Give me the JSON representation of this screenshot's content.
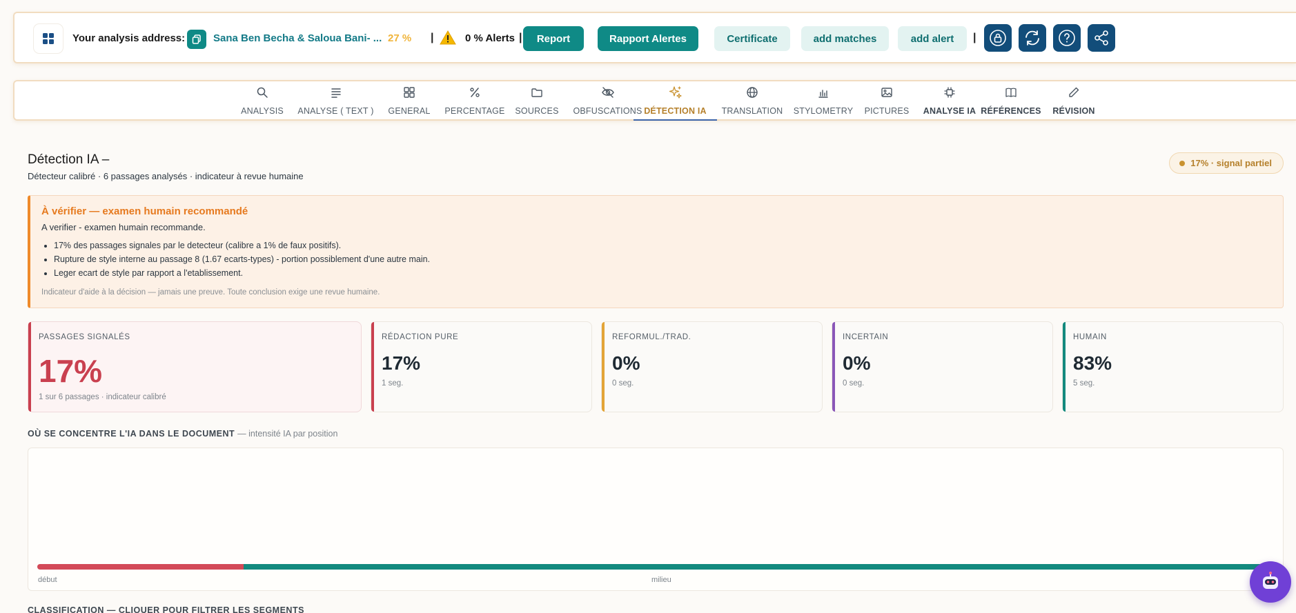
{
  "topbar": {
    "address_label": "Your analysis address:",
    "address_name": "Sana Ben Becha & Saloua Bani- ...",
    "percent": "27 %",
    "alerts": "0 % Alerts",
    "buttons": {
      "report": "Report",
      "rapport_alertes": "Rapport Alertes",
      "certificate": "Certificate",
      "add_matches": "add matches",
      "add_alert": "add alert"
    },
    "separator": "|",
    "icons": [
      "lock-icon",
      "refresh-icon",
      "help-icon",
      "share-icon"
    ]
  },
  "nav": {
    "tabs": [
      {
        "label": "ANALYSIS",
        "icon": "search-icon"
      },
      {
        "label": "ANALYSE ( TEXT )",
        "icon": "text-lines-icon"
      },
      {
        "label": "GENERAL",
        "icon": "grid-icon"
      },
      {
        "label": "PERCENTAGE",
        "icon": "percent-icon"
      },
      {
        "label": "SOURCES",
        "icon": "folder-icon"
      },
      {
        "label": "OBFUSCATIONS",
        "icon": "eye-off-icon"
      },
      {
        "label": "DÉTECTION IA",
        "icon": "sparkles-icon",
        "active": true
      },
      {
        "label": "TRANSLATION",
        "icon": "globe-icon"
      },
      {
        "label": "STYLOMETRY",
        "icon": "bar-chart-icon"
      },
      {
        "label": "PICTURES",
        "icon": "image-icon"
      },
      {
        "label": "ANALYSE IA",
        "icon": "chip-icon"
      },
      {
        "label": "RÉFÉRENCES",
        "icon": "book-icon"
      },
      {
        "label": "RÉVISION",
        "icon": "pencil-icon"
      }
    ]
  },
  "header": {
    "title": "Détection IA –",
    "subtitle": "Détecteur calibré · 6 passages analysés · indicateur à revue humaine",
    "signal": "17% · signal partiel"
  },
  "warning": {
    "title": "À vérifier — examen humain recommandé",
    "text": "A verifier - examen humain recommande.",
    "items": [
      "17% des passages signales par le detecteur (calibre a 1% de faux positifs).",
      "Rupture de style interne au passage 8 (1.67 ecarts-types) - portion possiblement d'une autre main.",
      "Leger ecart de style par rapport a l'etablissement."
    ],
    "note": "Indicateur d'aide à la décision — jamais une preuve. Toute conclusion exige une revue humaine."
  },
  "cards": [
    {
      "label": "PASSAGES SIGNALÉS",
      "value": "17%",
      "sub": "1 sur 6 passages · indicateur calibré",
      "color": "#c9404f"
    },
    {
      "label": "RÉDACTION PURE",
      "value": "17%",
      "sub": "1 seg.",
      "color": "#c9404f"
    },
    {
      "label": "REFORMUL./TRAD.",
      "value": "0%",
      "sub": "0 seg.",
      "color": "#e3a437"
    },
    {
      "label": "INCERTAIN",
      "value": "0%",
      "sub": "0 seg.",
      "color": "#8a57b8"
    },
    {
      "label": "HUMAIN",
      "value": "83%",
      "sub": "5 seg.",
      "color": "#138a7e"
    }
  ],
  "distribution": {
    "title": "OÙ SE CONCENTRE L'IA DANS LE DOCUMENT",
    "title_note": "— intensité IA par position",
    "segments": [
      {
        "share": 0.167,
        "color": "#d34a58"
      },
      {
        "share": 0.833,
        "color": "#138a7e"
      }
    ],
    "label_start": "début",
    "label_middle": "milieu"
  },
  "classification": {
    "title": "CLASSIFICATION — CLIQUER POUR FILTRER LES SEGMENTS"
  }
}
